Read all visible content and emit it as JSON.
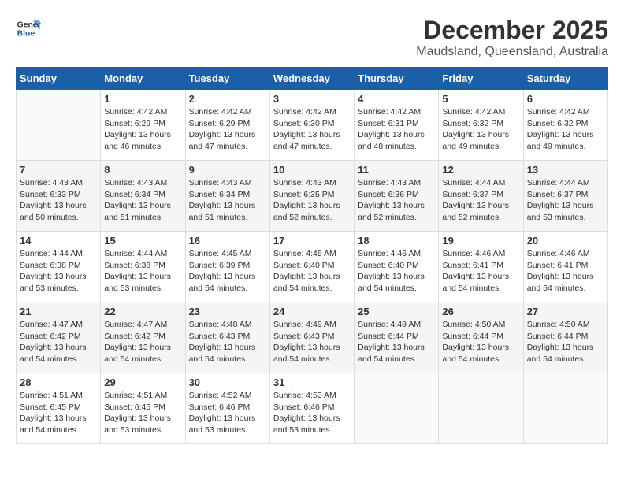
{
  "logo": {
    "line1": "General",
    "line2": "Blue"
  },
  "title": "December 2025",
  "subtitle": "Maudsland, Queensland, Australia",
  "days_header": [
    "Sunday",
    "Monday",
    "Tuesday",
    "Wednesday",
    "Thursday",
    "Friday",
    "Saturday"
  ],
  "weeks": [
    [
      {
        "num": "",
        "info": ""
      },
      {
        "num": "1",
        "info": "Sunrise: 4:42 AM\nSunset: 6:29 PM\nDaylight: 13 hours\nand 46 minutes."
      },
      {
        "num": "2",
        "info": "Sunrise: 4:42 AM\nSunset: 6:29 PM\nDaylight: 13 hours\nand 47 minutes."
      },
      {
        "num": "3",
        "info": "Sunrise: 4:42 AM\nSunset: 6:30 PM\nDaylight: 13 hours\nand 47 minutes."
      },
      {
        "num": "4",
        "info": "Sunrise: 4:42 AM\nSunset: 6:31 PM\nDaylight: 13 hours\nand 48 minutes."
      },
      {
        "num": "5",
        "info": "Sunrise: 4:42 AM\nSunset: 6:32 PM\nDaylight: 13 hours\nand 49 minutes."
      },
      {
        "num": "6",
        "info": "Sunrise: 4:42 AM\nSunset: 6:32 PM\nDaylight: 13 hours\nand 49 minutes."
      }
    ],
    [
      {
        "num": "7",
        "info": "Sunrise: 4:43 AM\nSunset: 6:33 PM\nDaylight: 13 hours\nand 50 minutes."
      },
      {
        "num": "8",
        "info": "Sunrise: 4:43 AM\nSunset: 6:34 PM\nDaylight: 13 hours\nand 51 minutes."
      },
      {
        "num": "9",
        "info": "Sunrise: 4:43 AM\nSunset: 6:34 PM\nDaylight: 13 hours\nand 51 minutes."
      },
      {
        "num": "10",
        "info": "Sunrise: 4:43 AM\nSunset: 6:35 PM\nDaylight: 13 hours\nand 52 minutes."
      },
      {
        "num": "11",
        "info": "Sunrise: 4:43 AM\nSunset: 6:36 PM\nDaylight: 13 hours\nand 52 minutes."
      },
      {
        "num": "12",
        "info": "Sunrise: 4:44 AM\nSunset: 6:37 PM\nDaylight: 13 hours\nand 52 minutes."
      },
      {
        "num": "13",
        "info": "Sunrise: 4:44 AM\nSunset: 6:37 PM\nDaylight: 13 hours\nand 53 minutes."
      }
    ],
    [
      {
        "num": "14",
        "info": "Sunrise: 4:44 AM\nSunset: 6:38 PM\nDaylight: 13 hours\nand 53 minutes."
      },
      {
        "num": "15",
        "info": "Sunrise: 4:44 AM\nSunset: 6:38 PM\nDaylight: 13 hours\nand 53 minutes."
      },
      {
        "num": "16",
        "info": "Sunrise: 4:45 AM\nSunset: 6:39 PM\nDaylight: 13 hours\nand 54 minutes."
      },
      {
        "num": "17",
        "info": "Sunrise: 4:45 AM\nSunset: 6:40 PM\nDaylight: 13 hours\nand 54 minutes."
      },
      {
        "num": "18",
        "info": "Sunrise: 4:46 AM\nSunset: 6:40 PM\nDaylight: 13 hours\nand 54 minutes."
      },
      {
        "num": "19",
        "info": "Sunrise: 4:46 AM\nSunset: 6:41 PM\nDaylight: 13 hours\nand 54 minutes."
      },
      {
        "num": "20",
        "info": "Sunrise: 4:46 AM\nSunset: 6:41 PM\nDaylight: 13 hours\nand 54 minutes."
      }
    ],
    [
      {
        "num": "21",
        "info": "Sunrise: 4:47 AM\nSunset: 6:42 PM\nDaylight: 13 hours\nand 54 minutes."
      },
      {
        "num": "22",
        "info": "Sunrise: 4:47 AM\nSunset: 6:42 PM\nDaylight: 13 hours\nand 54 minutes."
      },
      {
        "num": "23",
        "info": "Sunrise: 4:48 AM\nSunset: 6:43 PM\nDaylight: 13 hours\nand 54 minutes."
      },
      {
        "num": "24",
        "info": "Sunrise: 4:49 AM\nSunset: 6:43 PM\nDaylight: 13 hours\nand 54 minutes."
      },
      {
        "num": "25",
        "info": "Sunrise: 4:49 AM\nSunset: 6:44 PM\nDaylight: 13 hours\nand 54 minutes."
      },
      {
        "num": "26",
        "info": "Sunrise: 4:50 AM\nSunset: 6:44 PM\nDaylight: 13 hours\nand 54 minutes."
      },
      {
        "num": "27",
        "info": "Sunrise: 4:50 AM\nSunset: 6:44 PM\nDaylight: 13 hours\nand 54 minutes."
      }
    ],
    [
      {
        "num": "28",
        "info": "Sunrise: 4:51 AM\nSunset: 6:45 PM\nDaylight: 13 hours\nand 54 minutes."
      },
      {
        "num": "29",
        "info": "Sunrise: 4:51 AM\nSunset: 6:45 PM\nDaylight: 13 hours\nand 53 minutes."
      },
      {
        "num": "30",
        "info": "Sunrise: 4:52 AM\nSunset: 6:46 PM\nDaylight: 13 hours\nand 53 minutes."
      },
      {
        "num": "31",
        "info": "Sunrise: 4:53 AM\nSunset: 6:46 PM\nDaylight: 13 hours\nand 53 minutes."
      },
      {
        "num": "",
        "info": ""
      },
      {
        "num": "",
        "info": ""
      },
      {
        "num": "",
        "info": ""
      }
    ]
  ]
}
